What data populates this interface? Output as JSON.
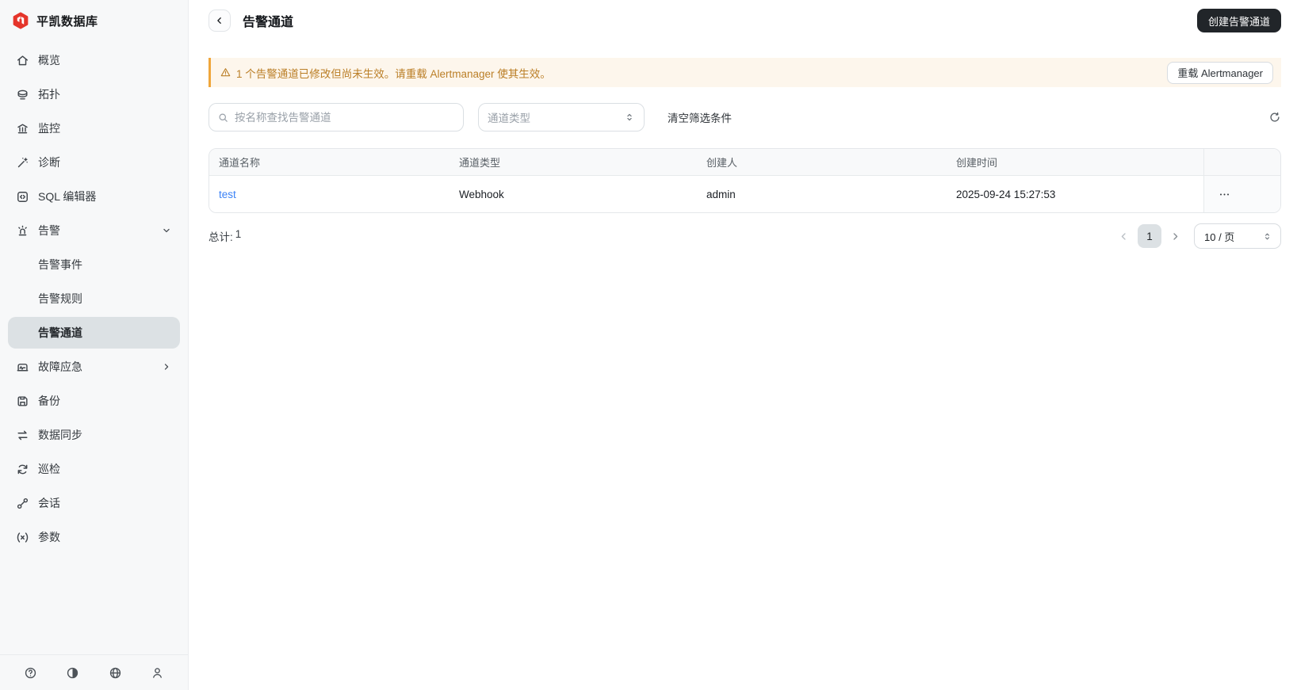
{
  "sidebar": {
    "brand": "平凯数据库",
    "items": [
      {
        "label": "概览"
      },
      {
        "label": "拓扑"
      },
      {
        "label": "监控"
      },
      {
        "label": "诊断"
      },
      {
        "label": "SQL 编辑器"
      },
      {
        "label": "告警"
      },
      {
        "label": "告警事件"
      },
      {
        "label": "告警规则"
      },
      {
        "label": "告警通道"
      },
      {
        "label": "故障应急"
      },
      {
        "label": "备份"
      },
      {
        "label": "数据同步"
      },
      {
        "label": "巡检"
      },
      {
        "label": "会话"
      },
      {
        "label": "参数"
      }
    ]
  },
  "header": {
    "title": "告警通道",
    "create_button": "创建告警通道"
  },
  "banner": {
    "message": "1 个告警通道已修改但尚未生效。请重载 Alertmanager 使其生效。",
    "reload_button": "重载 Alertmanager"
  },
  "filters": {
    "search_placeholder": "按名称查找告警通道",
    "type_select_placeholder": "通道类型",
    "clear_label": "清空筛选条件"
  },
  "table": {
    "columns": [
      "通道名称",
      "通道类型",
      "创建人",
      "创建时间"
    ],
    "rows": [
      {
        "name": "test",
        "type": "Webhook",
        "creator": "admin",
        "created_at": "2025-09-24 15:27:53"
      }
    ]
  },
  "pagination": {
    "total_label": "总计:",
    "total_value": "1",
    "current_page": "1",
    "page_size": "10 / 页"
  },
  "icons": {
    "brand": "hexagon-logo-icon",
    "sidebar": [
      "home-icon",
      "topology-icon",
      "monitor-icon",
      "diagnosis-icon",
      "sql-editor-icon",
      "alert-icon",
      "emergency-icon",
      "backup-icon",
      "sync-icon",
      "inspection-icon",
      "session-icon",
      "parameter-icon",
      "chevron-down-icon",
      "chevron-right-icon"
    ],
    "footer": [
      "help-icon",
      "theme-icon",
      "globe-icon",
      "user-icon"
    ],
    "toolbar": [
      "back-icon",
      "search-icon",
      "select-arrows-icon",
      "refresh-icon",
      "warning-icon",
      "ellipsis-icon",
      "prev-page-icon",
      "next-page-icon"
    ]
  },
  "colors": {
    "accent_red": "#e5352b",
    "dark_button": "#212529",
    "warning_bg": "#fdf6ec",
    "warning_border": "#efa63b",
    "warning_text": "#bb7f27",
    "link_blue": "#3b82f6",
    "active_item_bg": "#dce1e4",
    "sidebar_bg": "#f7f8f9",
    "table_header_bg": "#f8f9fa"
  }
}
